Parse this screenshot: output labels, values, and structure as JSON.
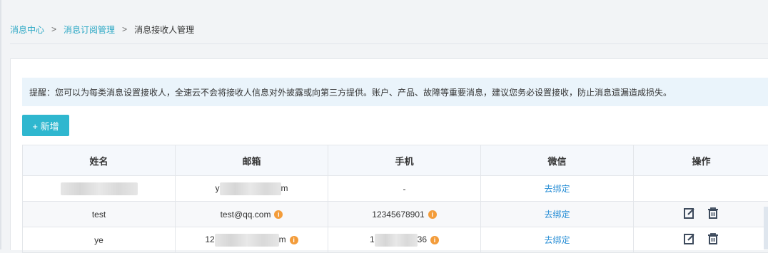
{
  "breadcrumb": {
    "level1": "消息中心",
    "sep": ">",
    "level2": "消息订阅管理",
    "current": "消息接收人管理"
  },
  "notice": "提醒：您可以为每类消息设置接收人，全速云不会将接收人信息对外披露或向第三方提供。账户、产品、故障等重要消息，建议您务必设置接收，防止消息遗漏造成损失。",
  "add_button": "+ 新增",
  "table": {
    "headers": [
      "姓名",
      "邮箱",
      "手机",
      "微信",
      "操作"
    ],
    "rows": [
      {
        "name": "",
        "email_prefix": "y",
        "email_suffix": "m",
        "phone": "-",
        "wechat": "去绑定"
      },
      {
        "name": "test",
        "email": "test@qq.com",
        "phone": "12345678901",
        "wechat": "去绑定"
      },
      {
        "name": "ye",
        "email_prefix": "12",
        "email_suffix": "m",
        "phone_prefix": "1",
        "phone_suffix": "36",
        "wechat": "去绑定"
      }
    ]
  },
  "icons": {
    "info": "info-icon",
    "edit": "edit-icon",
    "delete": "trash-icon"
  },
  "colors": {
    "accent": "#2fb7cf",
    "link": "#2a8fd6",
    "warning": "#f39c3a"
  }
}
